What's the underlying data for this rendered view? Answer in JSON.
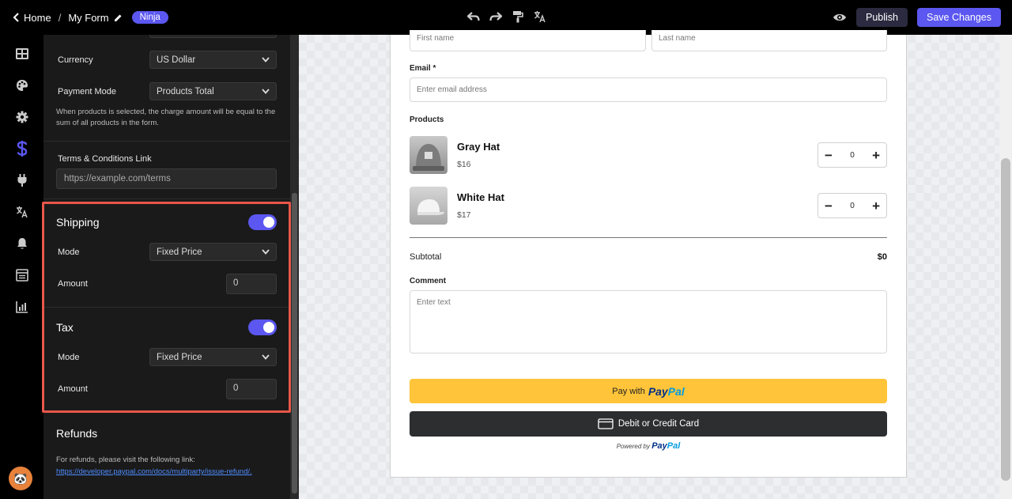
{
  "topbar": {
    "home_label": "Home",
    "separator": "/",
    "form_name": "My Form",
    "badge": "Ninja",
    "publish_label": "Publish",
    "save_label": "Save Changes"
  },
  "settings": {
    "currency_label": "Currency",
    "currency_value": "US Dollar",
    "payment_mode_label": "Payment Mode",
    "payment_mode_value": "Products Total",
    "payment_mode_help": "When products is selected, the charge amount will be equal to the sum of all products in the form.",
    "terms_label": "Terms & Conditions Link",
    "terms_placeholder": "https://example.com/terms",
    "shipping": {
      "title": "Shipping",
      "enabled": true,
      "mode_label": "Mode",
      "mode_value": "Fixed Price",
      "amount_label": "Amount",
      "amount_value": "0"
    },
    "tax": {
      "title": "Tax",
      "enabled": true,
      "mode_label": "Mode",
      "mode_value": "Fixed Price",
      "amount_label": "Amount",
      "amount_value": "0"
    },
    "refunds": {
      "title": "Refunds",
      "text": "For refunds, please visit the following link:",
      "link": "https://developer.paypal.com/docs/multiparty/issue-refund/."
    }
  },
  "form": {
    "first_name_placeholder": "First name",
    "last_name_placeholder": "Last name",
    "email_label": "Email *",
    "email_placeholder": "Enter email address",
    "products_label": "Products",
    "products": [
      {
        "name": "Gray Hat",
        "price": "$16",
        "qty": "0"
      },
      {
        "name": "White Hat",
        "price": "$17",
        "qty": "0"
      }
    ],
    "subtotal_label": "Subtotal",
    "subtotal_value": "$0",
    "comment_label": "Comment",
    "comment_placeholder": "Enter text",
    "paypal_prefix": "Pay with",
    "paypal_logo_a": "Pay",
    "paypal_logo_b": "Pal",
    "card_label": "Debit or Credit Card",
    "powered_by": "Powered by"
  },
  "colors": {
    "accent": "#5b57f0",
    "highlight": "#e8574a",
    "paypal_yellow": "#ffc439"
  }
}
